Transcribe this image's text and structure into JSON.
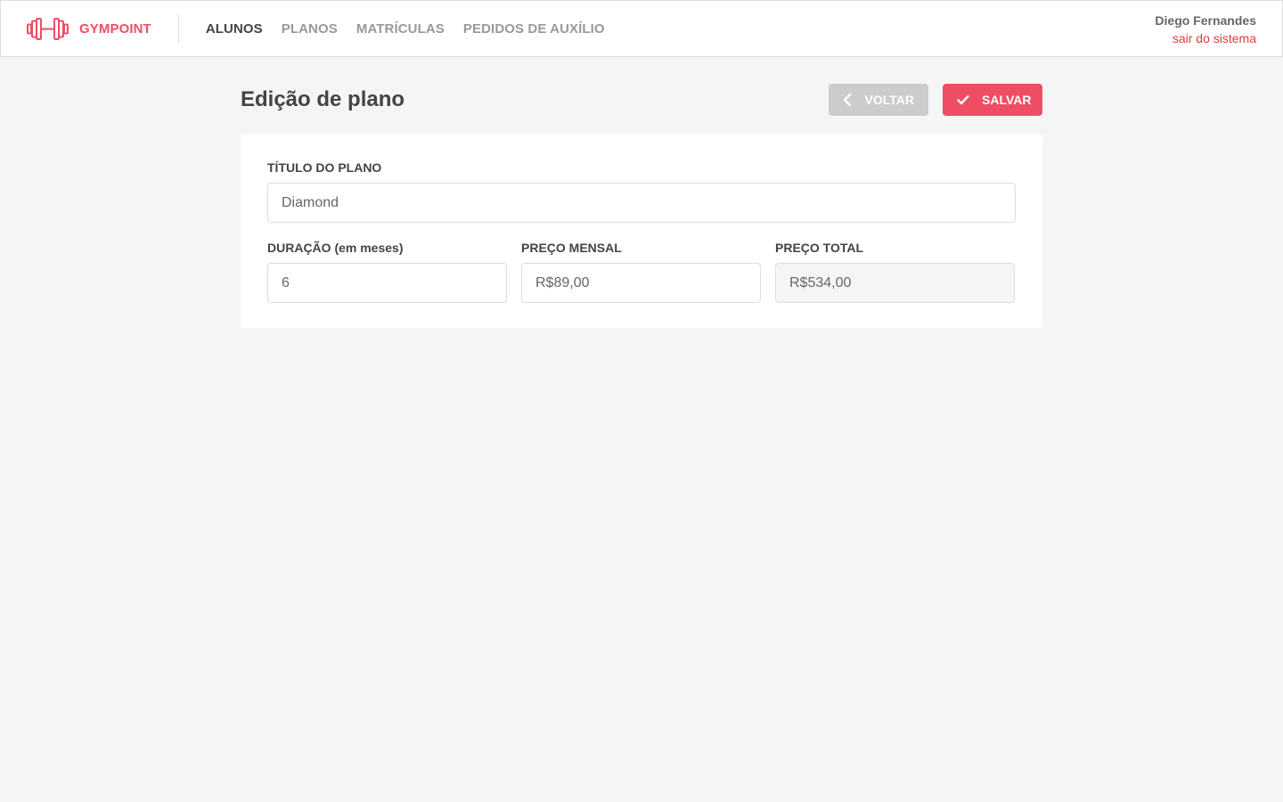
{
  "header": {
    "brand": "GYMPOINT",
    "logo_icon": "dumbbell-icon",
    "nav": [
      {
        "label": "ALUNOS",
        "active": true
      },
      {
        "label": "PLANOS",
        "active": false
      },
      {
        "label": "MATRÍCULAS",
        "active": false
      },
      {
        "label": "PEDIDOS DE AUXÍLIO",
        "active": false
      }
    ],
    "user": {
      "name": "Diego Fernandes",
      "logout_label": "sair do sistema"
    }
  },
  "page": {
    "title": "Edição de plano",
    "back_button": {
      "label": "VOLTAR",
      "icon": "chevron-left-icon"
    },
    "save_button": {
      "label": "SALVAR",
      "icon": "check-icon"
    }
  },
  "form": {
    "title": {
      "label": "TÍTULO DO PLANO",
      "value": "Diamond"
    },
    "duration": {
      "label": "DURAÇÃO (em meses)",
      "value": "6"
    },
    "monthly_price": {
      "label": "PREÇO MENSAL",
      "value": "R$89,00"
    },
    "total_price": {
      "label": "PREÇO TOTAL",
      "value": "R$534,00"
    }
  },
  "colors": {
    "brand": "#ee4d64",
    "logout": "#de3b3b",
    "background": "#f5f5f5",
    "button_secondary": "#cccccc"
  }
}
